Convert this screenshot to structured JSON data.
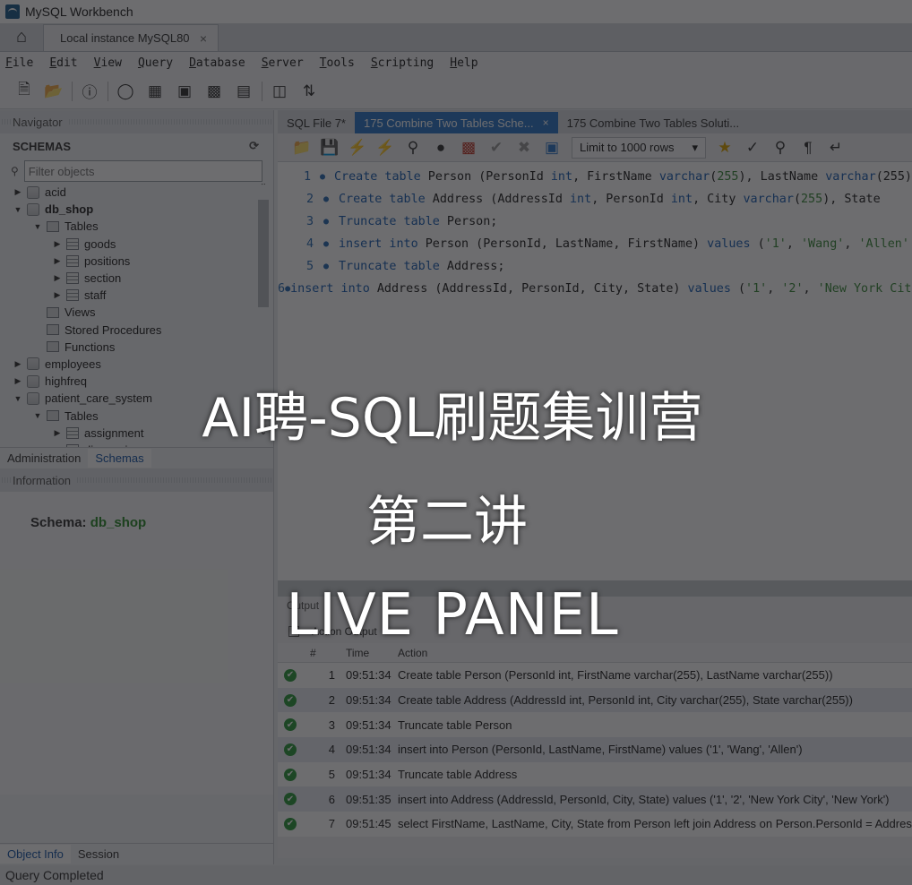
{
  "window": {
    "title": "MySQL Workbench"
  },
  "connection_tab": {
    "label": "Local instance MySQL80",
    "close": "×"
  },
  "menu": [
    "File",
    "Edit",
    "View",
    "Query",
    "Database",
    "Server",
    "Tools",
    "Scripting",
    "Help"
  ],
  "navigator": {
    "header": "Navigator",
    "schemas_label": "SCHEMAS",
    "filter_placeholder": "Filter objects",
    "tree": [
      {
        "label": "acid",
        "level": 0,
        "kind": "db",
        "expanded": false
      },
      {
        "label": "db_shop",
        "level": 0,
        "kind": "db",
        "expanded": true,
        "bold": true
      },
      {
        "label": "Tables",
        "level": 1,
        "kind": "folder",
        "expanded": true
      },
      {
        "label": "goods",
        "level": 2,
        "kind": "table",
        "expanded": false
      },
      {
        "label": "positions",
        "level": 2,
        "kind": "table",
        "expanded": false
      },
      {
        "label": "section",
        "level": 2,
        "kind": "table",
        "expanded": false
      },
      {
        "label": "staff",
        "level": 2,
        "kind": "table",
        "expanded": false
      },
      {
        "label": "Views",
        "level": 1,
        "kind": "folder"
      },
      {
        "label": "Stored Procedures",
        "level": 1,
        "kind": "folder"
      },
      {
        "label": "Functions",
        "level": 1,
        "kind": "folder"
      },
      {
        "label": "employees",
        "level": 0,
        "kind": "db",
        "expanded": false
      },
      {
        "label": "highfreq",
        "level": 0,
        "kind": "db",
        "expanded": false
      },
      {
        "label": "patient_care_system",
        "level": 0,
        "kind": "db",
        "expanded": true
      },
      {
        "label": "Tables",
        "level": 1,
        "kind": "folder",
        "expanded": true
      },
      {
        "label": "assignment",
        "level": 2,
        "kind": "table",
        "expanded": false
      },
      {
        "label": "diagnosis",
        "level": 2,
        "kind": "table",
        "expanded": false
      }
    ],
    "subtabs": [
      "Administration",
      "Schemas"
    ]
  },
  "information": {
    "header": "Information",
    "schema_label": "Schema:",
    "schema_value": "db_shop",
    "tabs": [
      "Object Info",
      "Session"
    ]
  },
  "editor": {
    "tabs": [
      {
        "label": "SQL File 7*",
        "active": false
      },
      {
        "label": "175 Combine Two Tables Sche...",
        "active": true,
        "close": "×"
      },
      {
        "label": "175 Combine Two Tables Soluti...",
        "active": false
      }
    ],
    "limit": "Limit to 1000 rows",
    "lines": [
      {
        "n": "1",
        "tokens": [
          [
            "kw",
            "Create table"
          ],
          [
            "t",
            " Person (PersonId "
          ],
          [
            "kw",
            "int"
          ],
          [
            "t",
            ", FirstName "
          ],
          [
            "kw",
            "varchar"
          ],
          [
            "t",
            "("
          ],
          [
            "str",
            "255"
          ],
          [
            "t",
            "), LastName "
          ],
          [
            "kw",
            "varchar"
          ],
          [
            "t",
            "(255)"
          ]
        ]
      },
      {
        "n": "2",
        "tokens": [
          [
            "kw",
            "Create table"
          ],
          [
            "t",
            " Address (AddressId "
          ],
          [
            "kw",
            "int"
          ],
          [
            "t",
            ", PersonId "
          ],
          [
            "kw",
            "int"
          ],
          [
            "t",
            ", City "
          ],
          [
            "kw",
            "varchar"
          ],
          [
            "t",
            "("
          ],
          [
            "str",
            "255"
          ],
          [
            "t",
            "), State"
          ]
        ]
      },
      {
        "n": "3",
        "tokens": [
          [
            "kw",
            "Truncate table"
          ],
          [
            "t",
            " Person;"
          ]
        ]
      },
      {
        "n": "4",
        "tokens": [
          [
            "kw",
            "insert into"
          ],
          [
            "t",
            " Person (PersonId, LastName, FirstName) "
          ],
          [
            "kw",
            "values"
          ],
          [
            "t",
            " ("
          ],
          [
            "str",
            "'1'"
          ],
          [
            "t",
            ", "
          ],
          [
            "str",
            "'Wang'"
          ],
          [
            "t",
            ", "
          ],
          [
            "str",
            "'Allen'"
          ]
        ]
      },
      {
        "n": "5",
        "tokens": [
          [
            "kw",
            "Truncate table"
          ],
          [
            "t",
            " Address;"
          ]
        ]
      },
      {
        "n": "6",
        "tokens": [
          [
            "kw",
            "insert into"
          ],
          [
            "t",
            " Address (AddressId, PersonId, City, State) "
          ],
          [
            "kw",
            "values"
          ],
          [
            "t",
            " ("
          ],
          [
            "str",
            "'1'"
          ],
          [
            "t",
            ", "
          ],
          [
            "str",
            "'2'"
          ],
          [
            "t",
            ", "
          ],
          [
            "str",
            "'New York City'"
          ]
        ]
      }
    ]
  },
  "output": {
    "header": "Output",
    "mode": "Action Output",
    "columns": [
      "#",
      "Time",
      "Action"
    ],
    "rows": [
      {
        "num": "1",
        "time": "09:51:34",
        "action": "Create table Person (PersonId int, FirstName varchar(255), LastName varchar(255))"
      },
      {
        "num": "2",
        "time": "09:51:34",
        "action": "Create table Address (AddressId int, PersonId int, City varchar(255), State varchar(255))"
      },
      {
        "num": "3",
        "time": "09:51:34",
        "action": "Truncate table Person"
      },
      {
        "num": "4",
        "time": "09:51:34",
        "action": "insert into Person (PersonId, LastName, FirstName) values ('1', 'Wang', 'Allen')"
      },
      {
        "num": "5",
        "time": "09:51:34",
        "action": "Truncate table Address"
      },
      {
        "num": "6",
        "time": "09:51:35",
        "action": "insert into Address (AddressId, PersonId, City, State) values ('1', '2', 'New York City', 'New York')"
      },
      {
        "num": "7",
        "time": "09:51:45",
        "action": "select FirstName, LastName, City, State from Person left join Address on Person.PersonId = Address.PersonId"
      }
    ]
  },
  "status": "Query Completed",
  "overlay": {
    "title": "AI聘-SQL刷题集训营",
    "subtitle": "第二讲",
    "live": "LIVE PANEL"
  },
  "colors": {
    "active_tab": "#2f76c8",
    "keyword": "#1b5fb3",
    "string": "#3b8a3b",
    "success": "#2e9a3e",
    "overlay": "rgba(20,20,22,0.62)"
  }
}
